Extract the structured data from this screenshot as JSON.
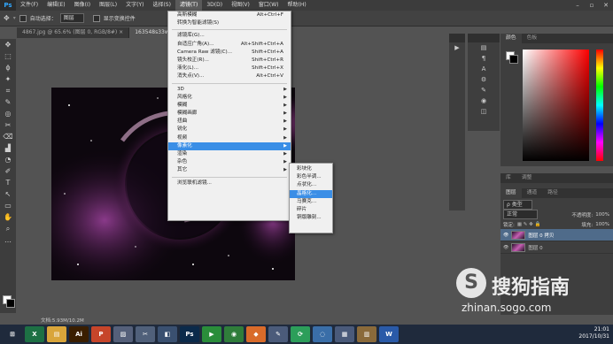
{
  "app": {
    "logo": "Ps"
  },
  "menubar": {
    "items": [
      "文件(F)",
      "编辑(E)",
      "图像(I)",
      "图层(L)",
      "文字(Y)",
      "选择(S)",
      "滤镜(T)",
      "3D(D)",
      "视图(V)",
      "窗口(W)",
      "帮助(H)"
    ],
    "active_index": 6,
    "window_controls": [
      "–",
      "▫",
      "✕"
    ]
  },
  "options_bar": {
    "auto_select_label": "自动选择：",
    "auto_select_value": "图层",
    "show_transform_label": "显示变换控件"
  },
  "tabs": [
    {
      "label": "4867.jpg @ 65.6% (图层 0, RGB/8#) × ",
      "active": false
    },
    {
      "label": "163548s33wghrw...",
      "active": true
    }
  ],
  "tools": [
    "✥",
    "⬚",
    "ϕ",
    "✦",
    "⌗",
    "✎",
    "◎",
    "✂",
    "⌫",
    "▟",
    "◔",
    "✐",
    "T",
    "↖",
    "▭",
    "✋",
    "⌕",
    "…"
  ],
  "filter_menu": {
    "top_items": [
      {
        "label": "高斯模糊",
        "shortcut": "Alt+Ctrl+F"
      },
      {
        "label": "转换为智能滤镜(S)",
        "shortcut": ""
      }
    ],
    "group2": [
      {
        "label": "滤镜库(G)...",
        "shortcut": ""
      },
      {
        "label": "自适应广角(A)...",
        "shortcut": "Alt+Shift+Ctrl+A"
      },
      {
        "label": "Camera Raw 滤镜(C)...",
        "shortcut": "Shift+Ctrl+A"
      },
      {
        "label": "镜头校正(R)...",
        "shortcut": "Shift+Ctrl+R"
      },
      {
        "label": "液化(L)...",
        "shortcut": "Shift+Ctrl+X"
      },
      {
        "label": "消失点(V)...",
        "shortcut": "Alt+Ctrl+V"
      }
    ],
    "group3": [
      {
        "label": "3D"
      },
      {
        "label": "风格化"
      },
      {
        "label": "模糊"
      },
      {
        "label": "模糊画廊"
      },
      {
        "label": "扭曲"
      },
      {
        "label": "锐化"
      },
      {
        "label": "视频"
      },
      {
        "label": "像素化"
      },
      {
        "label": "渲染"
      },
      {
        "label": "杂色"
      },
      {
        "label": "其它"
      }
    ],
    "group3_highlight_index": 7,
    "bottom_item": "浏览联机滤镜..."
  },
  "pixelate_submenu": {
    "items": [
      "彩块化",
      "彩色半调...",
      "点状化...",
      "晶格化...",
      "马赛克...",
      "碎片",
      "铜版雕刻..."
    ],
    "highlight_index": 3
  },
  "right_panel": {
    "color_tabs": [
      "颜色",
      "色板"
    ],
    "layers_top_tabs": [
      "库",
      "调整"
    ],
    "layers_tabs": [
      "图层",
      "通道",
      "路径"
    ],
    "kind_label": "ρ 类型",
    "blend_mode": "正常",
    "opacity_label": "不透明度:",
    "opacity_value": "100%",
    "lock_label": "锁定:",
    "fill_label": "填充:",
    "fill_value": "100%",
    "layers": [
      {
        "name": "图层 0 拷贝",
        "selected": true
      },
      {
        "name": "图层 0",
        "selected": false
      }
    ]
  },
  "status_bar": {
    "doc_info": "文档:5.93M/10.2M"
  },
  "taskbar": {
    "apps": [
      {
        "icon": "windows-icon",
        "label": "⊞",
        "color": "#1f2a3c"
      },
      {
        "icon": "excel-icon",
        "label": "X",
        "color": "#1d7044"
      },
      {
        "icon": "explorer-icon",
        "label": "▤",
        "color": "#d9a53a"
      },
      {
        "icon": "illustrator-icon",
        "label": "Ai",
        "color": "#3a1e00"
      },
      {
        "icon": "powerpoint-icon",
        "label": "P",
        "color": "#c6452a"
      },
      {
        "icon": "image-viewer-icon",
        "label": "▨",
        "color": "#55607a"
      },
      {
        "icon": "screenshot-icon",
        "label": "✂",
        "color": "#50607a"
      },
      {
        "icon": "app-icon",
        "label": "◧",
        "color": "#3a5070"
      },
      {
        "icon": "photoshop-icon",
        "label": "Ps",
        "color": "#0b2a4a"
      },
      {
        "icon": "video-player-icon",
        "label": "▶",
        "color": "#2a8d3a"
      },
      {
        "icon": "browser-icon",
        "label": "◉",
        "color": "#2f7d3a"
      },
      {
        "icon": "app-icon-2",
        "label": "◆",
        "color": "#d96b2a"
      },
      {
        "icon": "tool-icon",
        "label": "✎",
        "color": "#4b5b7a"
      },
      {
        "icon": "app-icon-3",
        "label": "⟳",
        "color": "#2c9e5a"
      },
      {
        "icon": "network-icon",
        "label": "◌",
        "color": "#3a6ea8"
      },
      {
        "icon": "gallery-icon",
        "label": "▦",
        "color": "#4a5a7a"
      },
      {
        "icon": "folder-icon",
        "label": "▥",
        "color": "#8a6a3a"
      },
      {
        "icon": "word-icon",
        "label": "W",
        "color": "#2a5aa8"
      }
    ],
    "time": "21:01",
    "date": "2017/10/31"
  },
  "watermark": {
    "brand": "搜狗指南",
    "url": "zhinan.sogo.com"
  },
  "colors": {
    "accent": "#3a8ee6",
    "photoshop_blue": "#31a8ff"
  }
}
